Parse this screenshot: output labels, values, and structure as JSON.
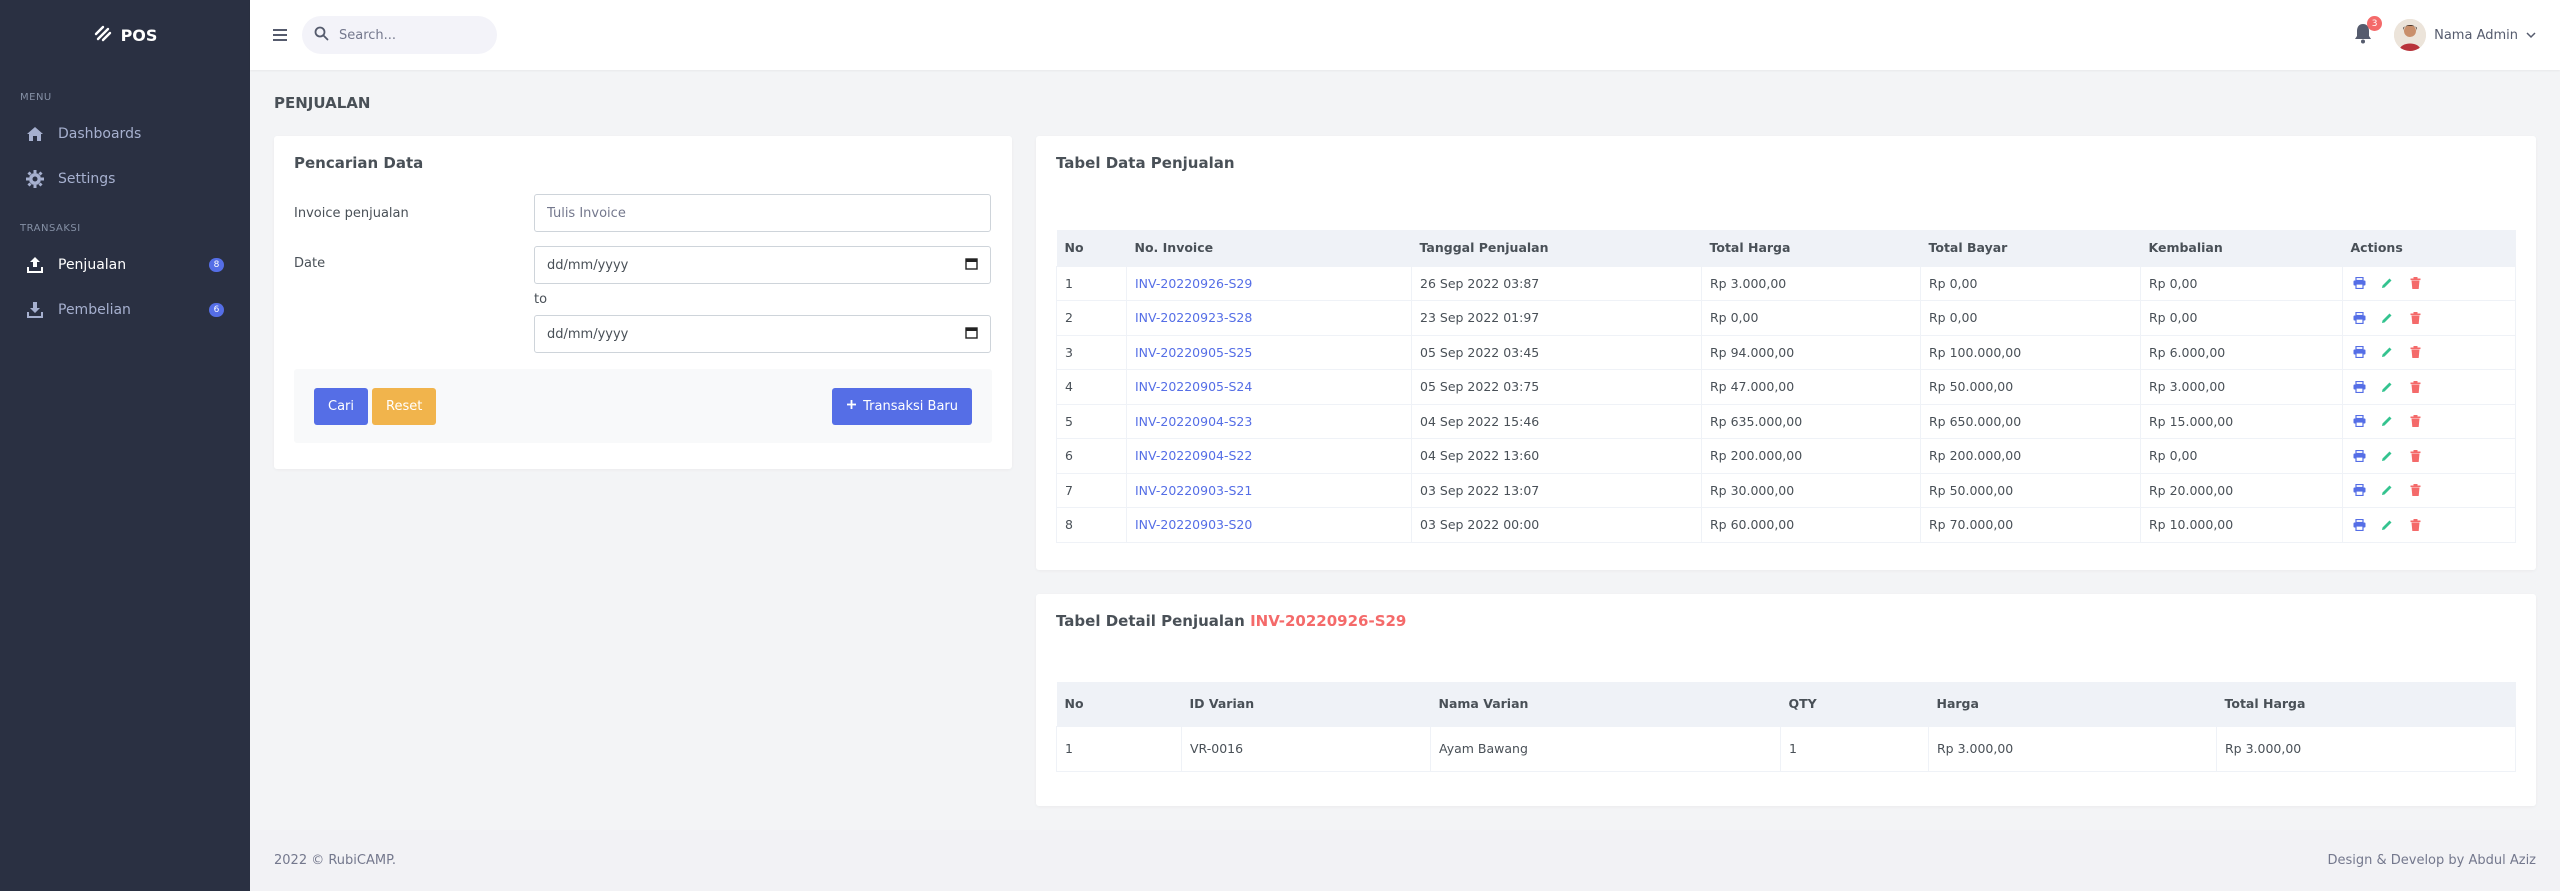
{
  "brand": {
    "name": "POS"
  },
  "sidebar": {
    "menu_title": "MENU",
    "menu_items": [
      {
        "label": "Dashboards",
        "icon": "home-icon"
      },
      {
        "label": "Settings",
        "icon": "gear-icon"
      }
    ],
    "transaksi_title": "TRANSAKSI",
    "transaksi_items": [
      {
        "label": "Penjualan",
        "icon": "upload-icon",
        "badge": "8"
      },
      {
        "label": "Pembelian",
        "icon": "download-icon",
        "badge": "6"
      }
    ]
  },
  "topbar": {
    "search_placeholder": "Search...",
    "notification_count": "3",
    "user_name": "Nama Admin"
  },
  "page": {
    "title": "PENJUALAN"
  },
  "search_form": {
    "title": "Pencarian Data",
    "invoice_label": "Invoice penjualan",
    "invoice_placeholder": "Tulis Invoice",
    "date_label": "Date",
    "date_from": "dd/mm/yyyy",
    "to_label": "to",
    "date_to": "dd/mm/yyyy",
    "cari_label": "Cari",
    "reset_label": "Reset",
    "new_label": "Transaksi Baru"
  },
  "sales_table": {
    "title": "Tabel Data Penjualan",
    "columns": [
      "No",
      "No. Invoice",
      "Tanggal Penjualan",
      "Total Harga",
      "Total Bayar",
      "Kembalian",
      "Actions"
    ],
    "rows": [
      [
        "1",
        "INV-20220926-S29",
        "26 Sep 2022 03:87",
        "Rp 3.000,00",
        "Rp 0,00",
        "Rp 0,00"
      ],
      [
        "2",
        "INV-20220923-S28",
        "23 Sep 2022 01:97",
        "Rp 0,00",
        "Rp 0,00",
        "Rp 0,00"
      ],
      [
        "3",
        "INV-20220905-S25",
        "05 Sep 2022 03:45",
        "Rp 94.000,00",
        "Rp 100.000,00",
        "Rp 6.000,00"
      ],
      [
        "4",
        "INV-20220905-S24",
        "05 Sep 2022 03:75",
        "Rp 47.000,00",
        "Rp 50.000,00",
        "Rp 3.000,00"
      ],
      [
        "5",
        "INV-20220904-S23",
        "04 Sep 2022 15:46",
        "Rp 635.000,00",
        "Rp 650.000,00",
        "Rp 15.000,00"
      ],
      [
        "6",
        "INV-20220904-S22",
        "04 Sep 2022 13:60",
        "Rp 200.000,00",
        "Rp 200.000,00",
        "Rp 0,00"
      ],
      [
        "7",
        "INV-20220903-S21",
        "03 Sep 2022 13:07",
        "Rp 30.000,00",
        "Rp 50.000,00",
        "Rp 20.000,00"
      ],
      [
        "8",
        "INV-20220903-S20",
        "03 Sep 2022 00:00",
        "Rp 60.000,00",
        "Rp 70.000,00",
        "Rp 10.000,00"
      ]
    ]
  },
  "detail_table": {
    "title": "Tabel Detail Penjualan",
    "invoice": "INV-20220926-S29",
    "columns": [
      "No",
      "ID Varian",
      "Nama Varian",
      "QTY",
      "Harga",
      "Total Harga"
    ],
    "rows": [
      [
        "1",
        "VR-0016",
        "Ayam Bawang",
        "1",
        "Rp 3.000,00",
        "Rp 3.000,00"
      ]
    ]
  },
  "footer": {
    "left": "2022 © RubiCAMP.",
    "right": "Design & Develop by Abdul Aziz"
  },
  "colors": {
    "sidebar_bg": "#2a3042",
    "primary": "#556ee6",
    "warning": "#f1b44c",
    "danger": "#f46a6a",
    "success": "#34c38f"
  }
}
